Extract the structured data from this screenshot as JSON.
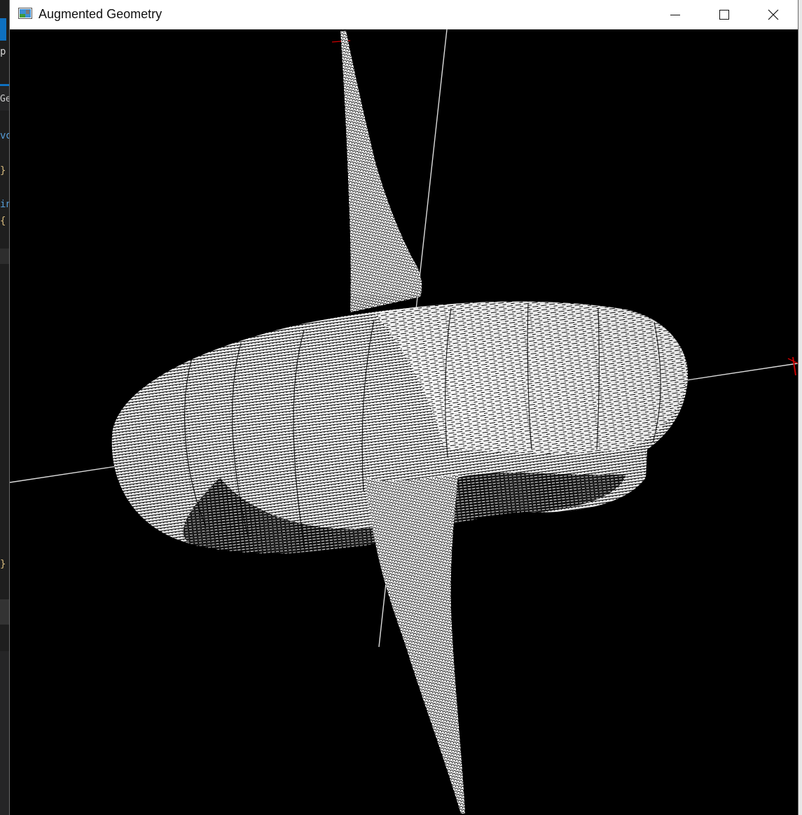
{
  "window": {
    "title": "Augmented Geometry",
    "app_icon": "image-icon",
    "controls": {
      "minimize": "minimize-icon",
      "maximize": "maximize-icon",
      "close": "close-icon"
    }
  },
  "background_editor": {
    "fragments": [
      "p",
      "Ge",
      "vo",
      "}",
      "in",
      "{",
      "}"
    ],
    "colors": {
      "keyword": "#569cd6",
      "brace": "#d7ba7d",
      "text": "#d4d4d4"
    }
  },
  "viewport": {
    "background": "#000000",
    "mesh_color": "#ffffff",
    "axis_color": "#dcdcdc",
    "marker_color": "#cc0000"
  }
}
